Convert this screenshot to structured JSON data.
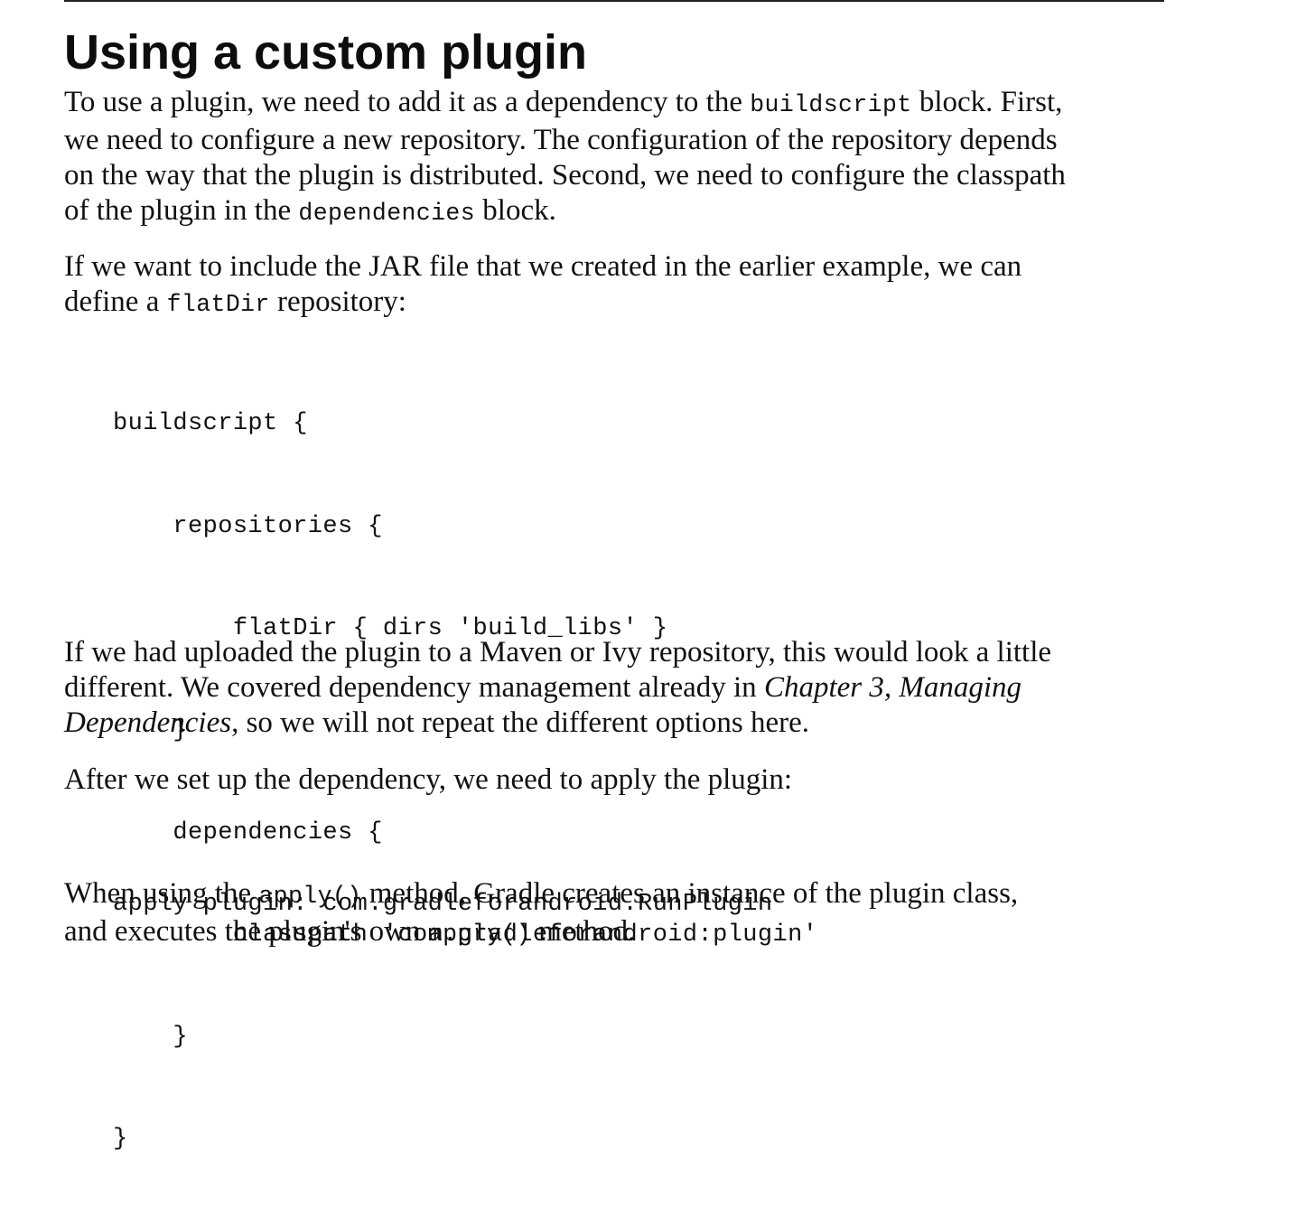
{
  "heading": "Using a custom plugin",
  "p1": {
    "l1a": "To use a plugin, we need to add it as a dependency to the ",
    "l1code": "buildscript",
    "l1b": " block. First,",
    "l2": "we need to configure a new repository. The configuration of the repository depends",
    "l3": "on the way that the plugin is distributed. Second, we need to configure the classpath",
    "l4a": "of the plugin in the ",
    "l4code": "dependencies",
    "l4b": " block."
  },
  "p2": {
    "l1": "If we want to include the JAR file that we created in the earlier example, we can",
    "l2a": "define a ",
    "l2code": "flatDir",
    "l2b": " repository:"
  },
  "code1": [
    "buildscript {",
    "    repositories {",
    "        flatDir { dirs 'build_libs' }",
    "    }",
    "    dependencies {",
    "        classpath 'com.gradleforandroid:plugin'",
    "    }",
    "}"
  ],
  "p3": {
    "l1": "If we had uploaded the plugin to a Maven or Ivy repository, this would look a little",
    "l2a": "different. We covered dependency management already in ",
    "l2ital": "Chapter 3, Managing",
    "l3ital": "Dependencies",
    "l3b": ", so we will not repeat the different options here."
  },
  "p4": {
    "l1": "After we set up the dependency, we need to apply the plugin:"
  },
  "code2": [
    "apply plugin: com.gradleforandroid.RunPlugin"
  ],
  "p5": {
    "l1a": "When using the ",
    "l1code": "apply()",
    "l1b": " method, Gradle creates an instance of the plugin class,",
    "l2a": "and executes the plugin's own ",
    "l2code": "apply()",
    "l2b": " method."
  }
}
